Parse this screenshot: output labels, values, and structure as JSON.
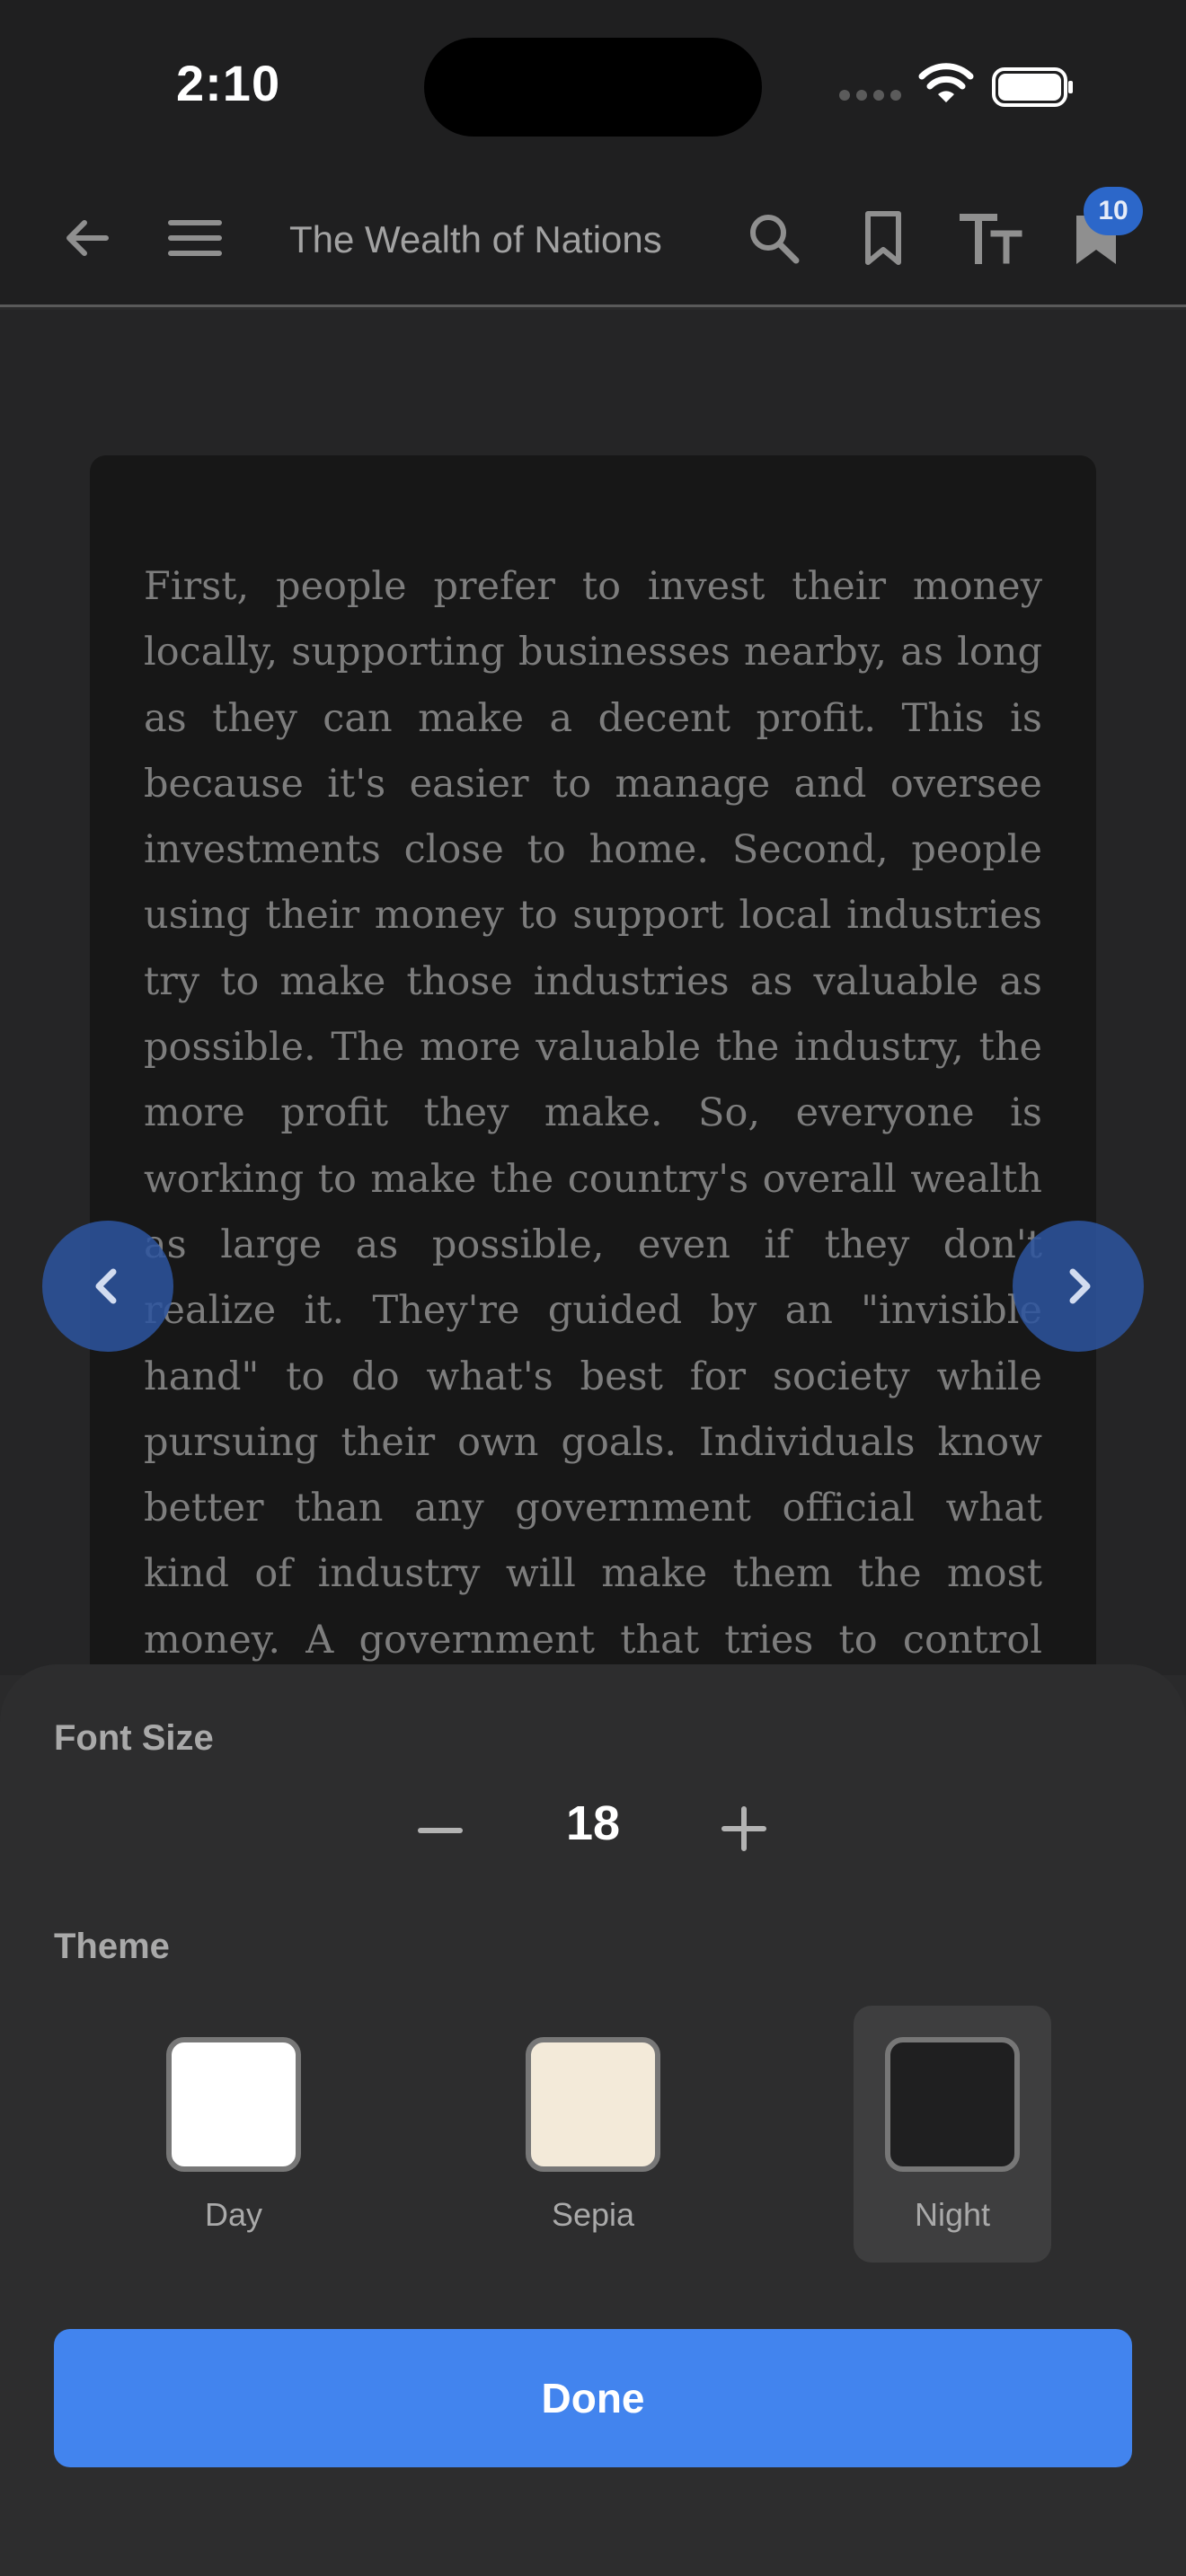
{
  "status_bar": {
    "time": "2:10"
  },
  "toolbar": {
    "book_title": "The Wealth of Nations",
    "bookmarks_badge": "10",
    "icons": [
      "back-arrow-icon",
      "menu-icon",
      "search-icon",
      "bookmark-icon",
      "text-size-icon",
      "bookmarks-list-icon"
    ]
  },
  "reader": {
    "page_text": "First, people prefer to invest their money locally, supporting businesses nearby, as long as they can make a decent profit. This is because it's easier to manage and oversee investments close to home. Second, people using their money to support local industries try to make those industries as valuable as possible. The more valuable the industry, the more profit they make. So, everyone is working to make the country's overall wealth as large as possible, even if they don't realize it. They're guided by an \"invisible hand\" to do what's best for society while pursuing their own goals. Individuals know better than any government official what kind of industry will make them the most money. A government that tries to control what people do with their money is overstepping its bounds and"
  },
  "settings": {
    "font_size_label": "Font Size",
    "font_size_value": "18",
    "theme_label": "Theme",
    "themes": [
      {
        "label": "Day",
        "color": "#ffffff"
      },
      {
        "label": "Sepia",
        "color": "#f3ead9"
      },
      {
        "label": "Night",
        "color": "#1f1f20"
      }
    ],
    "selected_theme": "Night",
    "done_label": "Done"
  },
  "colors": {
    "accent": "#4284ee",
    "badge": "#2c67c9",
    "nav_button": "#2c549e"
  }
}
